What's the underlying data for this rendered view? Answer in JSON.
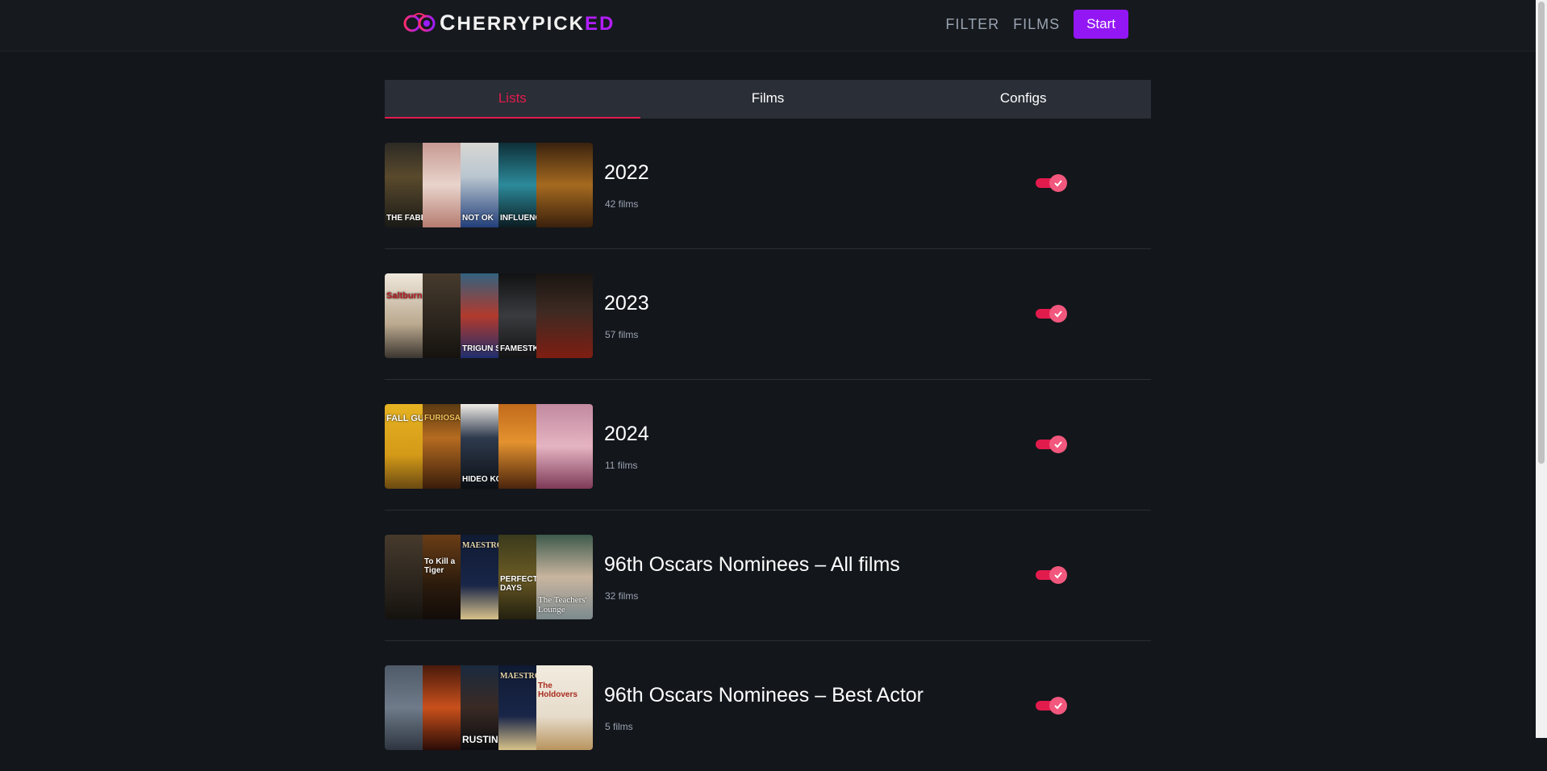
{
  "header": {
    "logo_text_a": "C",
    "logo_text_b": "HERRYPICK",
    "logo_text_c": "ED",
    "nav": [
      "FILTER",
      "FILMS"
    ],
    "start_label": "Start"
  },
  "tabs": [
    {
      "label": "Lists",
      "active": true
    },
    {
      "label": "Films",
      "active": false
    },
    {
      "label": "Configs",
      "active": false
    }
  ],
  "lists": [
    {
      "title": "2022",
      "count": "42 films",
      "enabled": true,
      "posters": [
        "THE FABELMANS",
        "",
        "NOT OK",
        "INFLUENCER",
        ""
      ]
    },
    {
      "title": "2023",
      "count": "57 films",
      "enabled": true,
      "posters": [
        "Saltburn",
        "",
        "TRIGUN STAMPEDE",
        "FAMESTKIN",
        ""
      ]
    },
    {
      "title": "2024",
      "count": "11 films",
      "enabled": true,
      "posters": [
        "FALL GUY",
        "FURIOSA",
        "HIDEO KOJIMA",
        "",
        ""
      ]
    },
    {
      "title": "96th Oscars Nominees – All films",
      "count": "32 films",
      "enabled": true,
      "posters": [
        "",
        "To Kill a Tiger",
        "MAESTRO",
        "PERFECT DAYS",
        "The Teachers' Lounge"
      ]
    },
    {
      "title": "96th Oscars Nominees – Best Actor",
      "count": "5 films",
      "enabled": true,
      "posters": [
        "",
        "",
        "RUSTIN",
        "MAESTRO",
        "The Holdovers"
      ]
    }
  ],
  "colors": {
    "accent": "#e21b4d",
    "start": "#9317f5",
    "background": "#13161b"
  }
}
